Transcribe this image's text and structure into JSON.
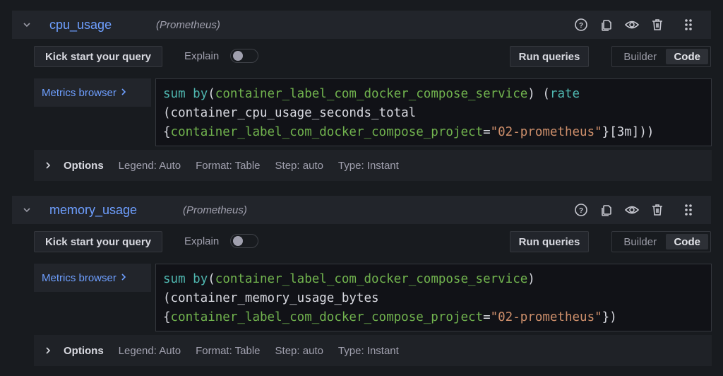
{
  "queries": [
    {
      "name": "cpu_usage",
      "datasource": "(Prometheus)",
      "kick_start_label": "Kick start your query",
      "explain_label": "Explain",
      "explain_enabled": false,
      "run_queries_label": "Run queries",
      "mode_options": [
        "Builder",
        "Code"
      ],
      "mode_selected": "Code",
      "metrics_browser_label": "Metrics browser",
      "query_lines": [
        [
          {
            "t": "sum",
            "c": "kw"
          },
          {
            "t": " ",
            "c": ""
          },
          {
            "t": "by",
            "c": "kw"
          },
          {
            "t": "(",
            "c": ""
          },
          {
            "t": "container_label_com_docker_compose_service",
            "c": "lbl"
          },
          {
            "t": ") (",
            "c": ""
          },
          {
            "t": "rate",
            "c": "kw"
          }
        ],
        [
          {
            "t": "(container_cpu_usage_seconds_total",
            "c": ""
          }
        ],
        [
          {
            "t": "{",
            "c": ""
          },
          {
            "t": "container_label_com_docker_compose_project",
            "c": "lbl"
          },
          {
            "t": "=",
            "c": ""
          },
          {
            "t": "\"02-prometheus\"",
            "c": "str"
          },
          {
            "t": "}[3m]))",
            "c": ""
          }
        ]
      ],
      "options": {
        "title": "Options",
        "legend": "Legend: Auto",
        "format": "Format: Table",
        "step": "Step: auto",
        "type": "Type: Instant"
      }
    },
    {
      "name": "memory_usage",
      "datasource": "(Prometheus)",
      "kick_start_label": "Kick start your query",
      "explain_label": "Explain",
      "explain_enabled": false,
      "run_queries_label": "Run queries",
      "mode_options": [
        "Builder",
        "Code"
      ],
      "mode_selected": "Code",
      "metrics_browser_label": "Metrics browser",
      "query_lines": [
        [
          {
            "t": "sum",
            "c": "kw"
          },
          {
            "t": " ",
            "c": ""
          },
          {
            "t": "by",
            "c": "kw"
          },
          {
            "t": "(",
            "c": ""
          },
          {
            "t": "container_label_com_docker_compose_service",
            "c": "lbl"
          },
          {
            "t": ")",
            "c": ""
          }
        ],
        [
          {
            "t": "(container_memory_usage_bytes",
            "c": ""
          }
        ],
        [
          {
            "t": "{",
            "c": ""
          },
          {
            "t": "container_label_com_docker_compose_project",
            "c": "lbl"
          },
          {
            "t": "=",
            "c": ""
          },
          {
            "t": "\"02-prometheus\"",
            "c": "str"
          },
          {
            "t": "})",
            "c": ""
          }
        ]
      ],
      "options": {
        "title": "Options",
        "legend": "Legend: Auto",
        "format": "Format: Table",
        "step": "Step: auto",
        "type": "Type: Instant"
      }
    }
  ],
  "icons": {
    "collapse": "chevron-down-icon",
    "help": "question-circle-icon",
    "duplicate": "copy-icon",
    "toggle_visibility": "eye-icon",
    "remove": "trash-icon",
    "drag": "drag-handle-icon",
    "metrics_browser": "chevron-right-icon",
    "options": "chevron-right-icon"
  },
  "colors": {
    "accent_blue": "#6e9fff",
    "keyword": "#4fb7b0",
    "label": "#71b34e",
    "string": "#ce8f6b"
  }
}
